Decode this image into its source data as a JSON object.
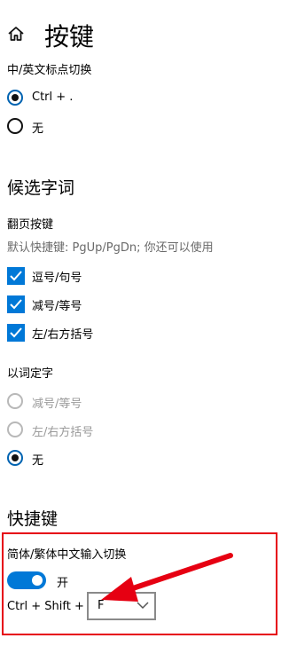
{
  "page": {
    "title": "按键"
  },
  "punctuation": {
    "label": "中/英文标点切换",
    "options": [
      "Ctrl + .",
      "无"
    ],
    "selected": "Ctrl + ."
  },
  "candidates": {
    "section_title": "候选字词",
    "paging_label": "翻页按键",
    "paging_desc": "默认快捷键: PgUp/PgDn; 你还可以使用",
    "paging_options": [
      {
        "label": "逗号/句号",
        "checked": true
      },
      {
        "label": "减号/等号",
        "checked": true
      },
      {
        "label": "左/右方括号",
        "checked": true
      }
    ],
    "word_label": "以词定字",
    "word_options": [
      {
        "label": "减号/等号",
        "enabled": false
      },
      {
        "label": "左/右方括号",
        "enabled": false
      },
      {
        "label": "无",
        "enabled": true,
        "selected": true
      }
    ]
  },
  "hotkeys": {
    "section_title": "快捷键",
    "switch_label": "简体/繁体中文输入切换",
    "toggle_state": "开",
    "combo_prefix": "Ctrl + Shift +",
    "combo_key": "F"
  },
  "colors": {
    "accent": "#0078d7",
    "highlight_border": "#e60012",
    "arrow": "#e60012"
  }
}
